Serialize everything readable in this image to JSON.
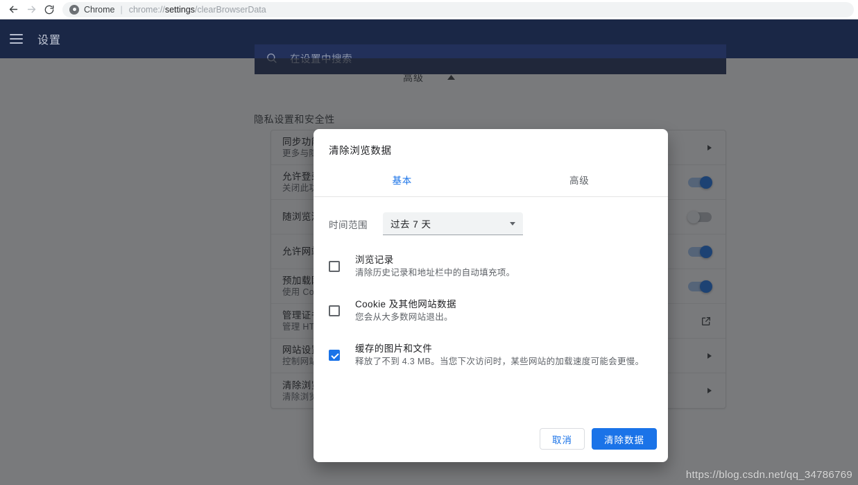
{
  "browser": {
    "back_icon": "arrow-left-icon",
    "forward_icon": "arrow-right-icon",
    "reload_icon": "reload-icon",
    "app_name": "Chrome",
    "separator": "|",
    "url_parts": {
      "scheme": "chrome://",
      "host": "settings",
      "path": "/clearBrowserData"
    },
    "url_full": "chrome://settings/clearBrowserData"
  },
  "header": {
    "menu_icon": "hamburger-menu-icon",
    "title": "设置",
    "search": {
      "icon": "search-icon",
      "placeholder": "在设置中搜索",
      "value": ""
    },
    "background_color": "#1a2746",
    "search_background_color": "#22305a"
  },
  "page": {
    "advanced_label": "高级",
    "advanced_caret": "chevron-up-icon",
    "section_title": "隐私设置和安全性",
    "rows": [
      {
        "title": "同步功能和",
        "sub": "更多与隐私",
        "control": "arrow"
      },
      {
        "title": "允许登录 C",
        "sub": "关闭此功能",
        "control": "toggle-on"
      },
      {
        "title": "随浏览流量",
        "sub": "",
        "control": "toggle-off"
      },
      {
        "title": "允许网站检",
        "sub": "",
        "control": "toggle-on"
      },
      {
        "title": "预加载网页",
        "sub": "使用 Cookie",
        "control": "toggle-on"
      },
      {
        "title": "管理证书",
        "sub": "管理 HTTPS",
        "control": "external-link"
      },
      {
        "title": "网站设置",
        "sub": "控制网站可",
        "control": "arrow"
      },
      {
        "title": "清除浏览数",
        "sub": "清除浏览记",
        "control": "arrow"
      }
    ]
  },
  "dialog": {
    "title": "清除浏览数据",
    "tabs": [
      {
        "label": "基本",
        "active": true
      },
      {
        "label": "高级",
        "active": false
      }
    ],
    "time_range": {
      "label": "时间范围",
      "value": "过去 7 天",
      "caret": "chevron-down-icon"
    },
    "options": [
      {
        "title": "浏览记录",
        "sub": "清除历史记录和地址栏中的自动填充项。",
        "checked": false
      },
      {
        "title": "Cookie 及其他网站数据",
        "sub": "您会从大多数网站退出。",
        "checked": false
      },
      {
        "title": "缓存的图片和文件",
        "sub": "释放了不到 4.3 MB。当您下次访问时，某些网站的加载速度可能会更慢。",
        "checked": true
      }
    ],
    "cancel_label": "取消",
    "confirm_label": "清除数据",
    "accent_color": "#1a73e8"
  },
  "watermark": "https://blog.csdn.net/qq_34786769"
}
